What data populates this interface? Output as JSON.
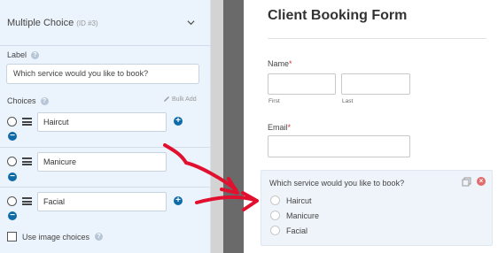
{
  "options_panel": {
    "field_title": "Multiple Choice",
    "field_id": "(ID #3)",
    "label_heading": "Label",
    "label_value": "Which service would you like to book?",
    "choices_heading": "Choices",
    "bulk_add": "Bulk Add",
    "choices": [
      {
        "value": "Haircut"
      },
      {
        "value": "Manicure"
      },
      {
        "value": "Facial"
      }
    ],
    "image_choices_label": "Use image choices"
  },
  "form_preview": {
    "title": "Client Booking Form",
    "name_label": "Name",
    "required_mark": "*",
    "first_sublabel": "First",
    "last_sublabel": "Last",
    "email_label": "Email",
    "question": "Which service would you like to book?",
    "options": [
      "Haircut",
      "Manicure",
      "Facial"
    ]
  },
  "colors": {
    "panel_bg": "#ebf3fc",
    "accent_blue": "#0e6ba8",
    "arrow_red": "#e0102e",
    "required_red": "#d63638",
    "selected_field_bg": "#eef4fa"
  },
  "icons": [
    "chevron-down-icon",
    "help-icon",
    "bulk-add-icon",
    "drag-handle-icon",
    "add-choice-icon",
    "remove-choice-icon",
    "duplicate-icon",
    "delete-icon",
    "arrow-icon"
  ]
}
